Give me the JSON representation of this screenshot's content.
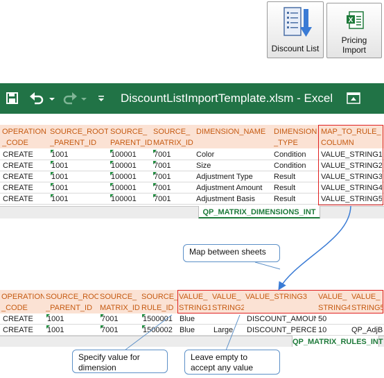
{
  "toolbar": {
    "discount_list": {
      "label": "Discount List",
      "icon": "list-icon"
    },
    "pricing_import": {
      "label_line1": "Pricing",
      "label_line2": "Import",
      "icon": "excel-icon"
    }
  },
  "excel": {
    "title": "DiscountListImportTemplate.xlsm - Excel",
    "accent": "#217346"
  },
  "dimensions_sheet": {
    "headers": [
      [
        "OPERATION",
        "_CODE"
      ],
      [
        "SOURCE_ROOT",
        "_PARENT_ID"
      ],
      [
        "SOURCE_",
        "PARENT_ID"
      ],
      [
        "SOURCE_",
        "MATRIX_ID"
      ],
      [
        "",
        "DIMENSION_NAME"
      ],
      [
        "DIMENSION",
        "_TYPE"
      ],
      [
        "MAP_TO_RULE_",
        "COLUMN"
      ]
    ],
    "rows": [
      [
        "CREATE",
        "1001",
        "100001",
        "7001",
        "Color",
        "Condition",
        "VALUE_STRING1"
      ],
      [
        "CREATE",
        "1001",
        "100001",
        "7001",
        "Size",
        "Condition",
        "VALUE_STRING2"
      ],
      [
        "CREATE",
        "1001",
        "100001",
        "7001",
        "Adjustment Type",
        "Result",
        "VALUE_STRING3"
      ],
      [
        "CREATE",
        "1001",
        "100001",
        "7001",
        "Adjustment Amount",
        "Result",
        "VALUE_STRING4"
      ],
      [
        "CREATE",
        "1001",
        "100001",
        "7001",
        "Adjustment Basis",
        "Result",
        "VALUE_STRING5"
      ]
    ],
    "tab_name": "QP_MATRIX_DIMENSIONS_INT"
  },
  "rules_sheet": {
    "headers": [
      [
        "OPERATION",
        "_CODE"
      ],
      [
        "SOURCE_ROOT",
        "_PARENT_ID"
      ],
      [
        "SOURCE_",
        "MATRIX_ID"
      ],
      [
        "SOURCE_",
        "RULE_ID"
      ],
      [
        "VALUE_",
        "STRING1"
      ],
      [
        "VALUE_",
        "STRING2"
      ],
      [
        "",
        "VALUE_STRING3"
      ],
      [
        "VALUE_",
        "STRING4"
      ],
      [
        "VALUE_",
        "STRING5"
      ]
    ],
    "rows": [
      [
        "CREATE",
        "1001",
        "7001",
        "1500001",
        "Blue",
        "",
        "DISCOUNT_AMOUNT",
        "50",
        ""
      ],
      [
        "CREATE",
        "1001",
        "7001",
        "1500002",
        "Blue",
        "Large",
        "DISCOUNT_PERCENT",
        "10",
        "QP_AdjBa"
      ]
    ],
    "tab_name": "QP_MATRIX_RULES_INT"
  },
  "callouts": {
    "map_between": "Map between  sheets",
    "specify_value": "Specify value  for dimension",
    "leave_empty": "Leave  empty to accept any value"
  },
  "colors": {
    "header_fill": "#fbe2d4",
    "header_text": "#c55a11",
    "highlight_box": "#e02020",
    "callout_border": "#5b8fc7"
  }
}
